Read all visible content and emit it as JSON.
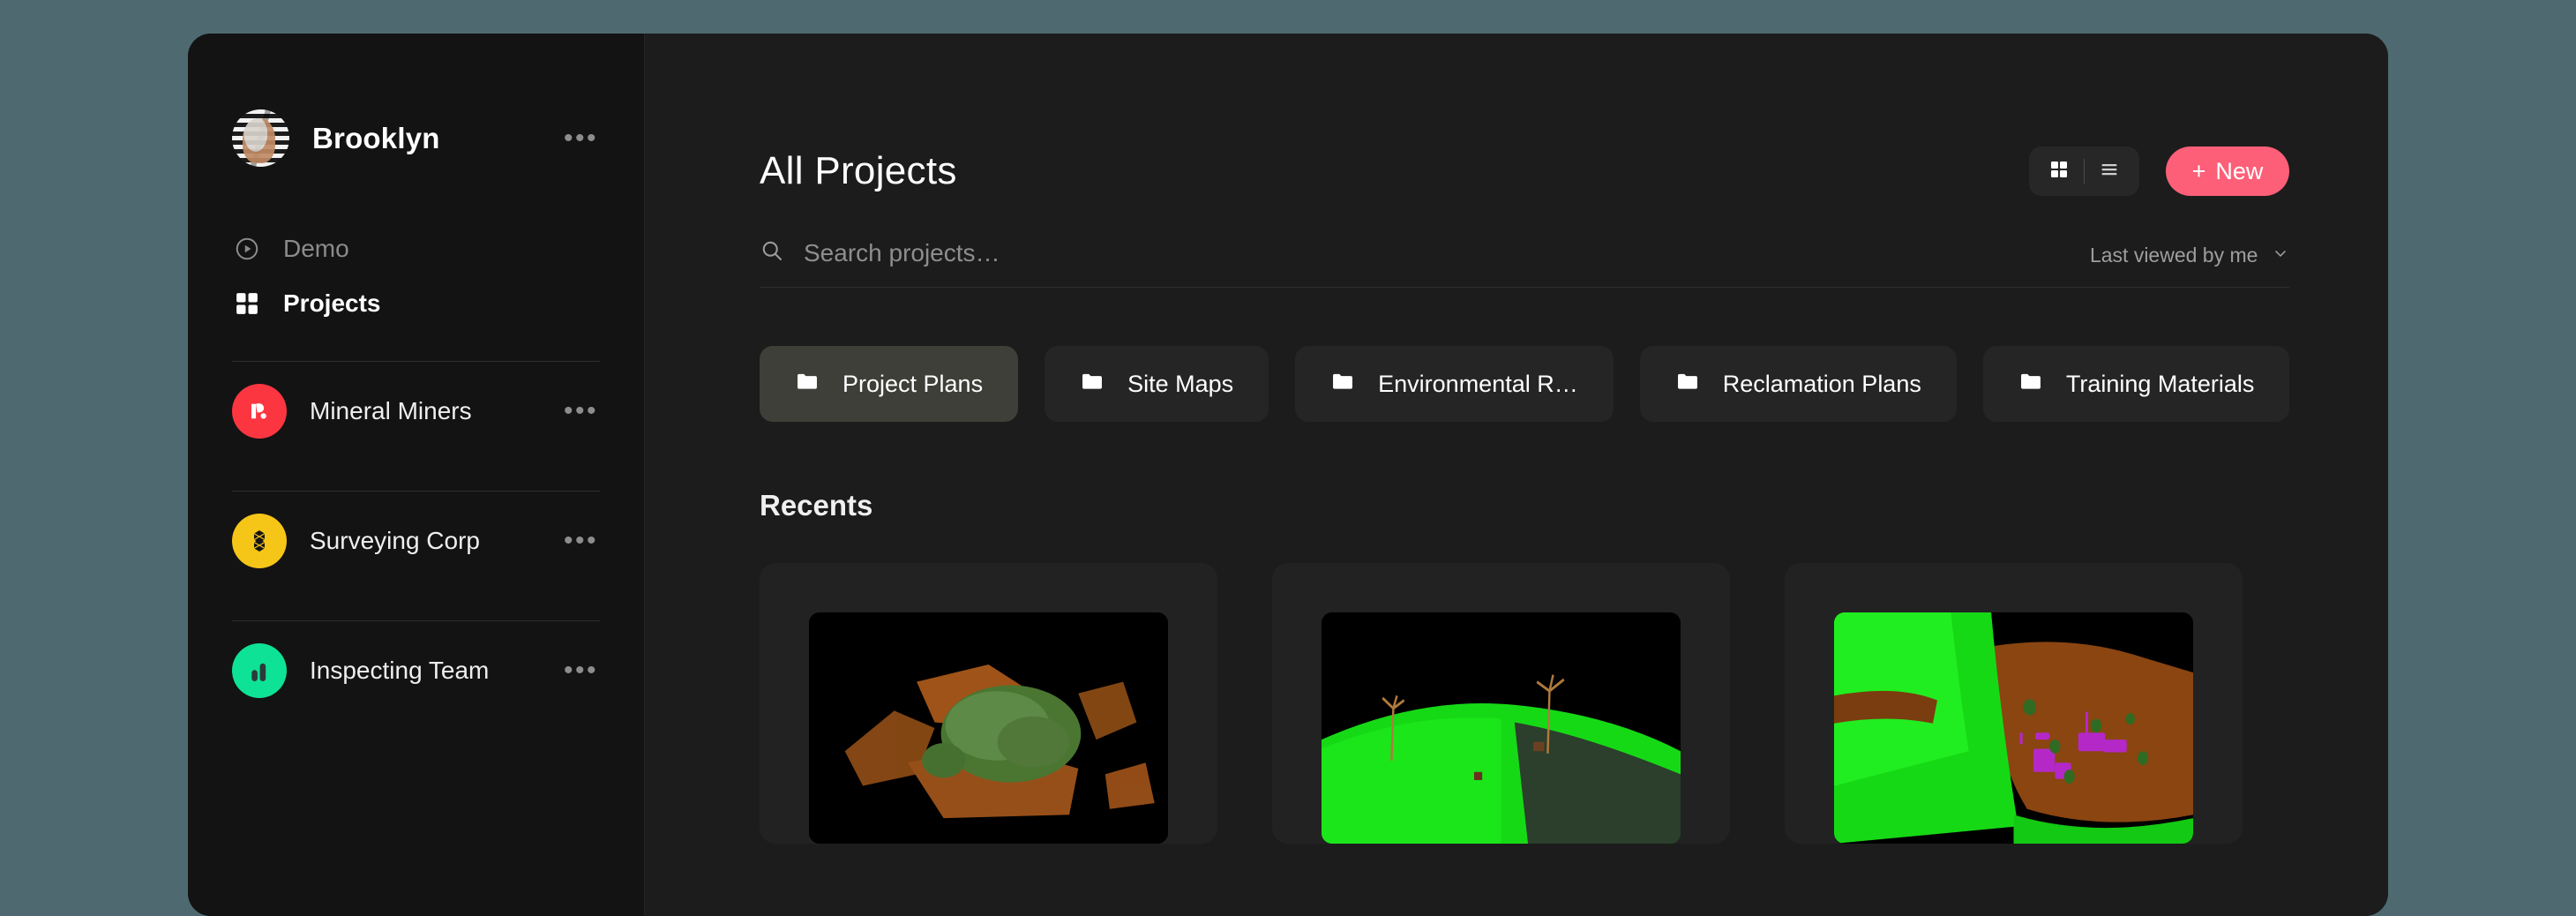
{
  "window": {
    "background_color": "#4e6a70",
    "app_background": "#1a1a1a"
  },
  "sidebar": {
    "profile": {
      "name": "Brooklyn",
      "avatar": "user-avatar",
      "menu": "•••"
    },
    "nav": [
      {
        "label": "Demo",
        "icon": "play-circle-icon",
        "active": false
      },
      {
        "label": "Projects",
        "icon": "grid-icon",
        "active": true
      }
    ],
    "workspaces": [
      {
        "label": "Mineral Miners",
        "icon": "mineral-miners-logo",
        "color": "#fb3640",
        "menu": "•••"
      },
      {
        "label": "Surveying Corp",
        "icon": "surveying-corp-logo",
        "color": "#f5c518",
        "menu": "•••"
      },
      {
        "label": "Inspecting Team",
        "icon": "inspecting-team-logo",
        "color": "#0ee296",
        "menu": "•••"
      }
    ]
  },
  "main": {
    "title": "All Projects",
    "toolbar": {
      "grid_view": "grid-view-icon",
      "list_view": "list-view-icon",
      "new_label": "New",
      "new_plus": "+",
      "accent_color": "#fd5f78"
    },
    "search": {
      "placeholder": "Search projects…",
      "value": "",
      "icon": "search-icon"
    },
    "sort": {
      "label": "Last viewed by me",
      "icon": "chevron-down-icon"
    },
    "folders": [
      {
        "label": "Project Plans",
        "icon": "folder-icon",
        "highlighted": true
      },
      {
        "label": "Site Maps",
        "icon": "folder-icon",
        "highlighted": false
      },
      {
        "label": "Environmental R…",
        "icon": "folder-icon",
        "highlighted": false
      },
      {
        "label": "Reclamation Plans",
        "icon": "folder-icon",
        "highlighted": false
      },
      {
        "label": "Training Materials",
        "icon": "folder-icon",
        "highlighted": false
      }
    ],
    "recents": {
      "heading": "Recents",
      "cards": [
        {
          "thumbnail": "point-cloud-terrain-orange-green"
        },
        {
          "thumbnail": "point-cloud-green-field-with-poles"
        },
        {
          "thumbnail": "point-cloud-aerial-forest-and-clearing"
        }
      ]
    }
  }
}
